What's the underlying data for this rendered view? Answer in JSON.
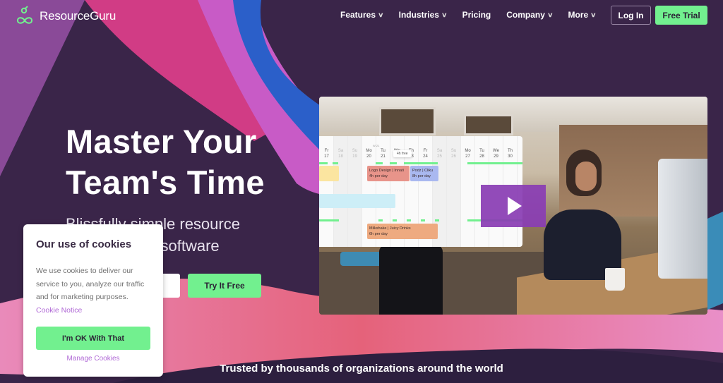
{
  "brand": {
    "name": "ResourceGuru",
    "accent": "#72f08f",
    "background": "#3a2549",
    "link_color": "#b069d6"
  },
  "nav": {
    "items": [
      {
        "label": "Features",
        "has_dropdown": true
      },
      {
        "label": "Industries",
        "has_dropdown": true
      },
      {
        "label": "Pricing",
        "has_dropdown": false
      },
      {
        "label": "Company",
        "has_dropdown": true
      },
      {
        "label": "More",
        "has_dropdown": true
      }
    ],
    "login_label": "Log In",
    "trial_label": "Free Trial"
  },
  "hero": {
    "title_line1": "Master Your",
    "title_line2": "Team's Time",
    "subtitle": "Blissfully simple resource management software",
    "email_placeholder": "",
    "cta_label": "Try It Free"
  },
  "video": {
    "calendar": {
      "week_label": "W 21",
      "days": [
        {
          "dow": "Fr",
          "date": "17",
          "weekend": false
        },
        {
          "dow": "Sa",
          "date": "18",
          "weekend": true
        },
        {
          "dow": "Su",
          "date": "19",
          "weekend": true
        },
        {
          "dow": "Mo",
          "date": "20",
          "weekend": false
        },
        {
          "dow": "Tu",
          "date": "21",
          "weekend": false
        },
        {
          "dow": "We",
          "date": "22",
          "weekend": false
        },
        {
          "dow": "Th",
          "date": "23",
          "weekend": false
        },
        {
          "dow": "Fr",
          "date": "24",
          "weekend": false
        },
        {
          "dow": "Sa",
          "date": "25",
          "weekend": true
        },
        {
          "dow": "Su",
          "date": "26",
          "weekend": true
        },
        {
          "dow": "Mo",
          "date": "27",
          "weekend": false
        },
        {
          "dow": "Tu",
          "date": "28",
          "weekend": false
        },
        {
          "dow": "We",
          "date": "29",
          "weekend": false
        },
        {
          "dow": "Th",
          "date": "30",
          "weekend": false
        }
      ],
      "tooltip": "4h free",
      "bookings": [
        {
          "title": "Logo Design | Innati",
          "hours": "4h per day",
          "color": "#e8948a"
        },
        {
          "title": "Podz | Cliku",
          "hours": "8h per day",
          "color": "#a9b8f0"
        },
        {
          "title": "Milkshake | Juicy Drinks",
          "hours": "6h per day",
          "color": "#eeaa80"
        }
      ]
    },
    "play_label": "Play video"
  },
  "cookie": {
    "title": "Our use of cookies",
    "text": "We use cookies to deliver our service to you, analyze our traffic and for marketing purposes.",
    "notice_link": "Cookie Notice",
    "ok_label": "I'm OK With That",
    "manage_label": "Manage Cookies"
  },
  "trusted": "Trusted by thousands of organizations around the world"
}
